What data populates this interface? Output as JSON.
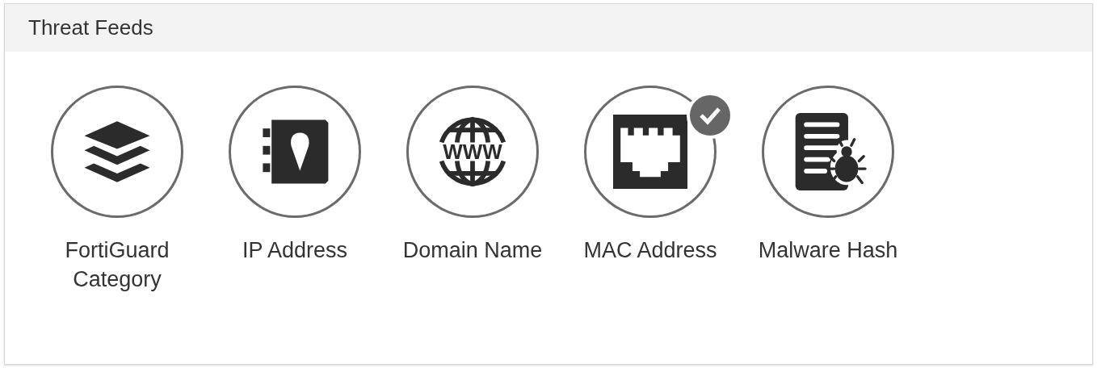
{
  "panel": {
    "title": "Threat Feeds"
  },
  "feeds": [
    {
      "kind": "layers",
      "label": "FortiGuard Category",
      "selected": false
    },
    {
      "kind": "addressbook",
      "label": "IP Address",
      "selected": false
    },
    {
      "kind": "globe",
      "label": "Domain Name",
      "icon_text": "WWW",
      "selected": false
    },
    {
      "kind": "port",
      "label": "MAC Address",
      "selected": true
    },
    {
      "kind": "malware",
      "label": "Malware Hash",
      "selected": false
    }
  ]
}
